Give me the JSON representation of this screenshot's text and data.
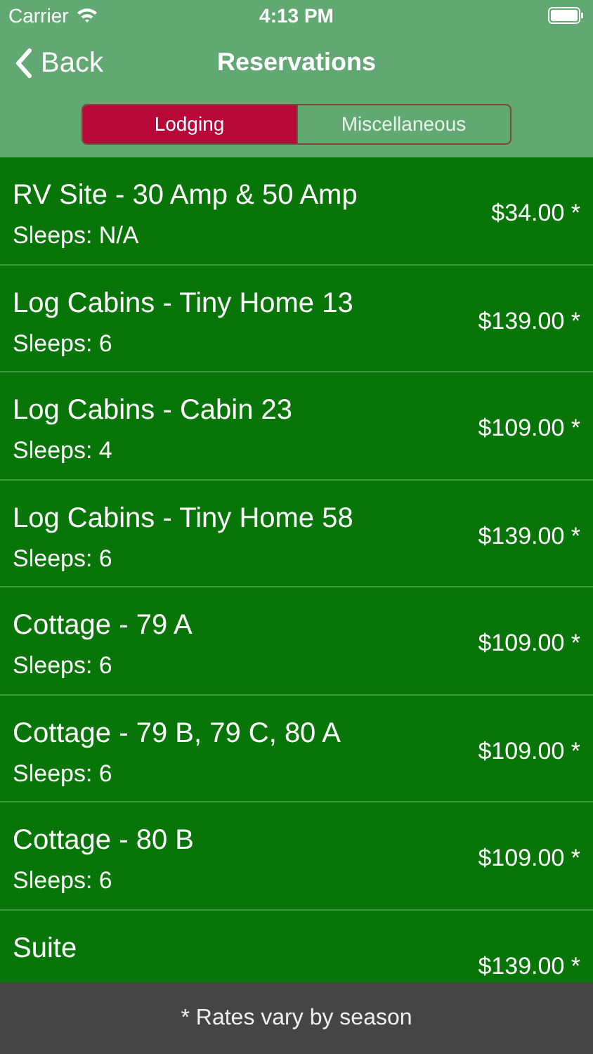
{
  "status_bar": {
    "carrier": "Carrier",
    "time": "4:13 PM"
  },
  "nav": {
    "back": "Back",
    "title": "Reservations"
  },
  "segments": [
    {
      "label": "Lodging",
      "selected": true
    },
    {
      "label": "Miscellaneous",
      "selected": false
    }
  ],
  "rows": [
    {
      "title": "RV Site - 30 Amp & 50 Amp",
      "sleeps": "Sleeps: N/A",
      "price": "$34.00 *"
    },
    {
      "title": "Log Cabins - Tiny Home 13",
      "sleeps": "Sleeps: 6",
      "price": "$139.00 *"
    },
    {
      "title": "Log Cabins - Cabin 23",
      "sleeps": "Sleeps: 4",
      "price": "$109.00 *"
    },
    {
      "title": "Log Cabins - Tiny Home 58",
      "sleeps": "Sleeps: 6",
      "price": "$139.00 *"
    },
    {
      "title": "Cottage - 79 A",
      "sleeps": "Sleeps: 6",
      "price": "$109.00 *"
    },
    {
      "title": "Cottage - 79 B, 79 C, 80 A",
      "sleeps": "Sleeps: 6",
      "price": "$109.00 *"
    },
    {
      "title": "Cottage - 80 B",
      "sleeps": "Sleeps: 6",
      "price": "$109.00 *"
    },
    {
      "title": "Suite",
      "price": "$139.00 *"
    }
  ],
  "footer": "* Rates vary by season"
}
